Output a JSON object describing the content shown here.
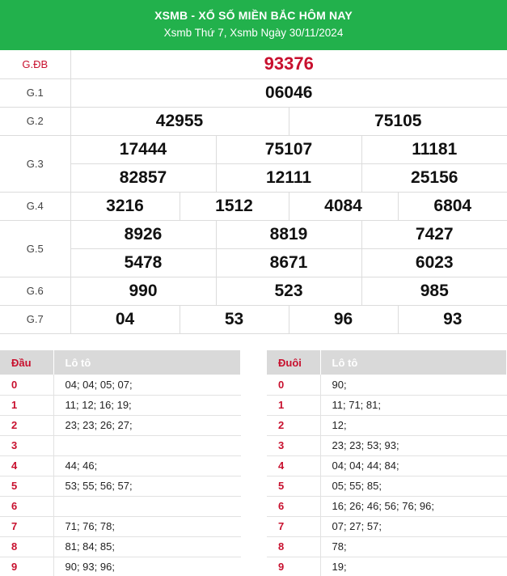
{
  "header": {
    "title": "XSMB - XỔ SỐ MIỀN BẮC HÔM NAY",
    "subtitle": "Xsmb Thứ 7, Xsmb Ngày 30/11/2024"
  },
  "prizes": {
    "gdb": {
      "label": "G.ĐB",
      "numbers": [
        "93376"
      ]
    },
    "g1": {
      "label": "G.1",
      "numbers": [
        "06046"
      ]
    },
    "g2": {
      "label": "G.2",
      "numbers": [
        "42955",
        "75105"
      ]
    },
    "g3": {
      "label": "G.3",
      "numbers": [
        "17444",
        "75107",
        "11181",
        "82857",
        "12111",
        "25156"
      ]
    },
    "g4": {
      "label": "G.4",
      "numbers": [
        "3216",
        "1512",
        "4084",
        "6804"
      ]
    },
    "g5": {
      "label": "G.5",
      "numbers": [
        "8926",
        "8819",
        "7427",
        "5478",
        "8671",
        "6023"
      ]
    },
    "g6": {
      "label": "G.6",
      "numbers": [
        "990",
        "523",
        "985"
      ]
    },
    "g7": {
      "label": "G.7",
      "numbers": [
        "04",
        "53",
        "96",
        "93"
      ]
    }
  },
  "loto_dau": {
    "key_header": "Đầu",
    "val_header": "Lô tô",
    "rows": [
      {
        "key": "0",
        "val": "04; 04; 05; 07;"
      },
      {
        "key": "1",
        "val": "11; 12; 16; 19;"
      },
      {
        "key": "2",
        "val": "23; 23; 26; 27;"
      },
      {
        "key": "3",
        "val": ""
      },
      {
        "key": "4",
        "val": "44; 46;"
      },
      {
        "key": "5",
        "val": "53; 55; 56; 57;"
      },
      {
        "key": "6",
        "val": ""
      },
      {
        "key": "7",
        "val": "71; 76; 78;"
      },
      {
        "key": "8",
        "val": "81; 84; 85;"
      },
      {
        "key": "9",
        "val": "90; 93; 96;"
      }
    ]
  },
  "loto_duoi": {
    "key_header": "Đuôi",
    "val_header": "Lô tô",
    "rows": [
      {
        "key": "0",
        "val": "90;"
      },
      {
        "key": "1",
        "val": "11; 71; 81;"
      },
      {
        "key": "2",
        "val": "12;"
      },
      {
        "key": "3",
        "val": "23; 23; 53; 93;"
      },
      {
        "key": "4",
        "val": "04; 04; 44; 84;"
      },
      {
        "key": "5",
        "val": "05; 55; 85;"
      },
      {
        "key": "6",
        "val": "16; 26; 46; 56; 76; 96;"
      },
      {
        "key": "7",
        "val": "07; 27; 57;"
      },
      {
        "key": "8",
        "val": "78;"
      },
      {
        "key": "9",
        "val": "19;"
      }
    ]
  },
  "colors": {
    "header_bg": "#22b14c",
    "accent_red": "#c8102e",
    "table_header_bg": "#d9d9d9"
  }
}
